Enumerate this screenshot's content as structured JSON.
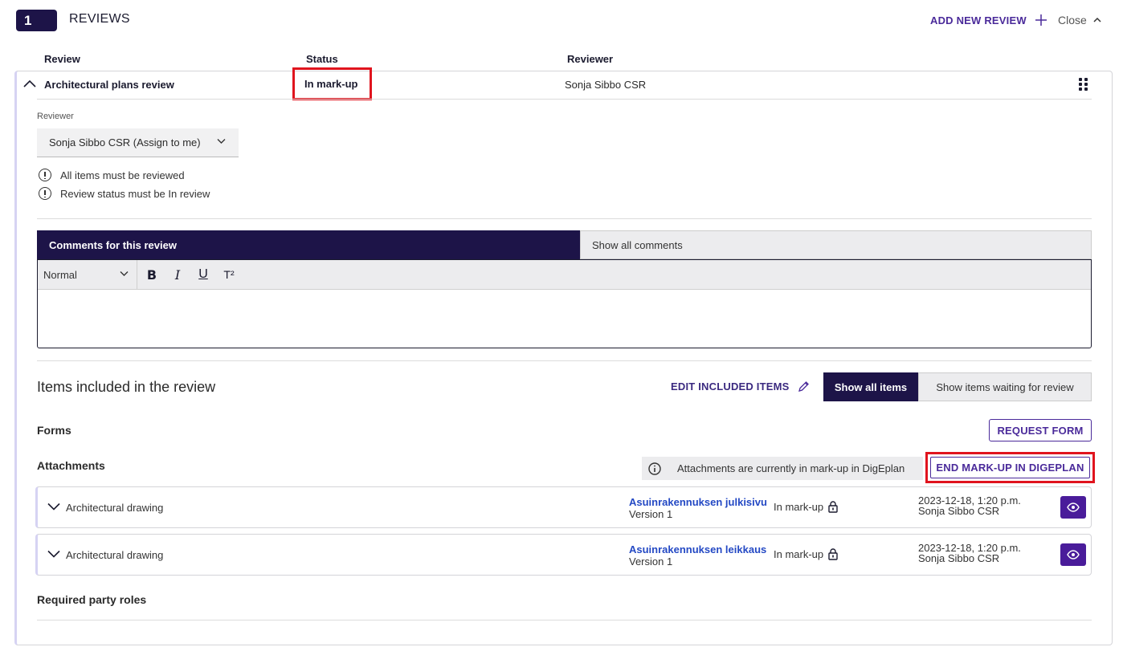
{
  "header": {
    "count": "1",
    "title": "REVIEWS",
    "add_review_label": "ADD NEW REVIEW",
    "close_label": "Close"
  },
  "columns": {
    "review": "Review",
    "status": "Status",
    "reviewer": "Reviewer"
  },
  "review": {
    "name": "Architectural plans review",
    "status": "In mark-up",
    "reviewer": "Sonja Sibbo CSR",
    "reviewer_field_label": "Reviewer",
    "reviewer_select_value": "Sonja Sibbo CSR (Assign to me)",
    "notes": [
      "All items must be reviewed",
      "Review status must be In review"
    ]
  },
  "comments": {
    "tab_active": "Comments for this review",
    "tab_inactive": "Show all comments",
    "format_value": "Normal",
    "toolbar": {
      "bold": "B",
      "italic": "I",
      "underline": "U",
      "superscript": "T²"
    }
  },
  "items": {
    "title": "Items included in the review",
    "edit_label": "EDIT INCLUDED ITEMS",
    "filter_active": "Show all items",
    "filter_inactive": "Show items waiting for review",
    "forms_label": "Forms",
    "request_form_label": "REQUEST FORM",
    "attachments_label": "Attachments",
    "markup_note": "Attachments are currently in mark-up in DigEplan",
    "end_markup_label": "END MARK-UP IN DIGEPLAN",
    "attachments": [
      {
        "type": "Architectural drawing",
        "name": "Asuinrakennuksen julkisivu",
        "version": "Version 1",
        "status": "In mark-up",
        "date": "2023-12-18, 1:20 p.m.",
        "user": "Sonja Sibbo CSR"
      },
      {
        "type": "Architectural drawing",
        "name": "Asuinrakennuksen leikkaus",
        "version": "Version 1",
        "status": "In mark-up",
        "date": "2023-12-18, 1:20 p.m.",
        "user": "Sonja Sibbo CSR"
      }
    ],
    "required_roles_label": "Required party roles"
  },
  "colors": {
    "brand_dark": "#1d1448",
    "accent_purple": "#4a2a9a",
    "link_blue": "#2449c4",
    "highlight_red": "#e0141e"
  }
}
